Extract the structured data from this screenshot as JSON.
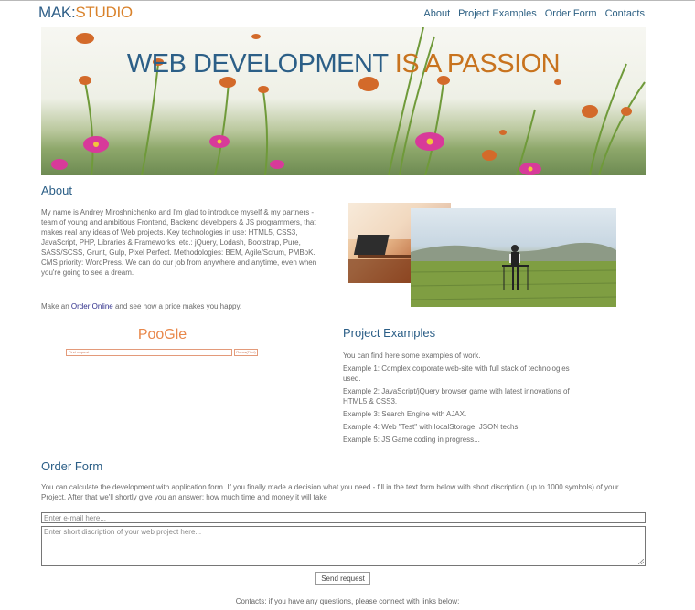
{
  "header": {
    "logo_part1": "MAK:",
    "logo_part2": "STUDIO",
    "nav": [
      "About",
      "Project Examples",
      "Order Form",
      "Contacts"
    ]
  },
  "hero": {
    "title_part1": "WEB DEVELOPMENT",
    "title_part2": "IS A PASSION"
  },
  "about": {
    "heading": "About",
    "text": "My name is Andrey Miroshnichenko and I'm glad to introduce myself & my partners - team of young and ambitious Frontend, Backend developers & JS programmers, that makes real any ideas of Web projects. Key technologies in use: HTML5, CSS3, JavaScript, PHP, Libraries & Frameworks, etc.: jQuery, Lodash, Bootstrap, Pure, SASS/SCSS, Grunt, Gulp, Pixel Perfect. Methodologies: BEM, Agile/Scrum, PMBoK. CMS priority: WordPress. We can do our job from anywhere and anytime, even when you're going to see a dream.",
    "order_prefix": "Make an",
    "order_link": "Order Online",
    "order_suffix": "and see how a price makes you happy."
  },
  "poogle": {
    "logo": "PooGle",
    "input_placeholder": "Find request",
    "button": "Поиск(Find)"
  },
  "projects": {
    "heading": "Project Examples",
    "intro": "You can find here some examples of work.",
    "items": [
      "Example 1: Complex corporate web-site with full stack of technologies used.",
      "Example 2: JavaScript/jQuery browser game with latest innovations of HTML5 & CSS3.",
      "Example 3: Search Engine with AJAX.",
      "Example 4: Web \"Test\" with localStorage, JSON techs.",
      "Example 5: JS Game coding in progress..."
    ]
  },
  "order_form": {
    "heading": "Order Form",
    "text": "You can calculate the development with application form. If you finally made a decision what you need - fill in the text form below with short discription (up to 1000 symbols) of your Project. After that we'll shortly give you an answer: how much time and money it will take",
    "email_placeholder": "Enter e-mail here...",
    "desc_placeholder": "Enter short discription of your web project here...",
    "send_label": "Send request"
  },
  "contacts": {
    "text": "Contacts: if you have any questions, please connect with links below:"
  },
  "colors": {
    "accent_blue": "#2c5f87",
    "accent_orange": "#c8731e"
  }
}
